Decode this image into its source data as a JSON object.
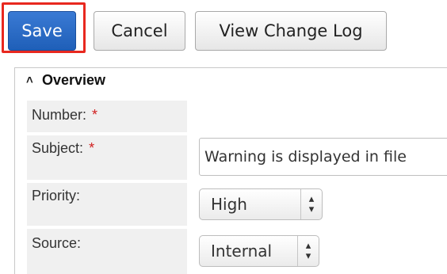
{
  "toolbar": {
    "save_label": "Save",
    "cancel_label": "Cancel",
    "changelog_label": "View Change Log"
  },
  "panel": {
    "title": "Overview",
    "collapse_icon": "double-chevron-up-icon"
  },
  "fields": {
    "number": {
      "label": "Number:",
      "required_marker": "*"
    },
    "subject": {
      "label": "Subject:",
      "required_marker": "*",
      "value": "Warning is displayed in file"
    },
    "priority": {
      "label": "Priority:",
      "value": "High"
    },
    "source": {
      "label": "Source:",
      "value": "Internal"
    }
  },
  "colors": {
    "save_button": "#2a6bc6",
    "highlight_border": "#e8281f",
    "required": "#d12020",
    "label_background": "#f0f0f0"
  }
}
